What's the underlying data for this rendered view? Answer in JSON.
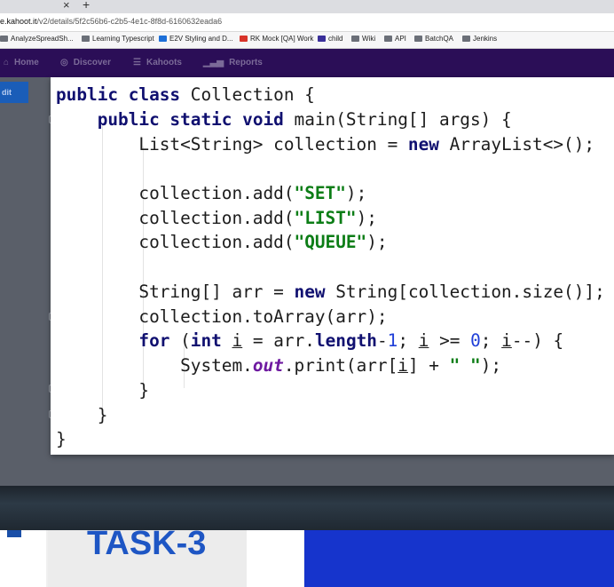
{
  "browser": {
    "tab_close": "×",
    "tab_new": "+",
    "url_host": "e.kahoot.it",
    "url_path": "/v2/details/5f2c56b6-c2b5-4e1c-8f8d-6160632eada6",
    "bookmarks": [
      "AnalyzeSpreadSh...",
      "Learning Typescript",
      "E2V Styling and D...",
      "RK Mock [QA] Work",
      "child",
      "Wiki",
      "API",
      "BatchQA",
      "Jenkins"
    ]
  },
  "nav": {
    "home": "Home",
    "discover": "Discover",
    "kahoots": "Kahoots",
    "reports": "Reports",
    "edit_label": "dit"
  },
  "code": [
    "public class Collection {",
    "    public static void main(String[] args) {",
    "        List<String> collection = new ArrayList<>();",
    "",
    "        collection.add(\"SET\");",
    "        collection.add(\"LIST\");",
    "        collection.add(\"QUEUE\");",
    "",
    "        String[] arr = new String[collection.size()];",
    "        collection.toArray(arr);",
    "        for (int i = arr.length-1; i >= 0; i--) {",
    "            System.out.print(arr[i] + \" \");",
    "        }",
    "    }",
    "}"
  ],
  "task": {
    "label": "TASK-3"
  },
  "colors": {
    "keyword": "#101070",
    "string": "#0c7d16",
    "number": "#1f3fd8",
    "nav_bg": "#2b0e57",
    "task_blue": "#1e56c4",
    "blue_tile": "#1634cc"
  }
}
